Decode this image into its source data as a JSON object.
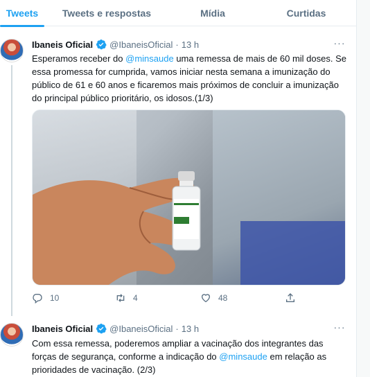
{
  "tabs": [
    {
      "label": "Tweets",
      "active": true
    },
    {
      "label": "Tweets e respostas",
      "active": false
    },
    {
      "label": "Mídia",
      "active": false
    },
    {
      "label": "Curtidas",
      "active": false
    }
  ],
  "colors": {
    "accent": "#1da1f2",
    "muted": "#5b7083",
    "text": "#0f1419"
  },
  "tweets": [
    {
      "name": "Ibaneis Oficial",
      "handle": "@IbaneisOficial",
      "time": "13 h",
      "text_before": "Esperamos receber do ",
      "mention": "@minsaude",
      "text_after": " uma remessa de mais de 60 mil doses. Se essa promessa for cumprida, vamos iniciar nesta semana a imunização do público de 61 e 60 anos e ficaremos mais próximos de concluir a imunização do principal público prioritário, os idosos.(1/3)",
      "media": {
        "icon": "vaccine-vial-photo",
        "vial_label_lines": [
          "vacina",
          "covid-19",
          "(recombinante)",
          "5 doses"
        ]
      },
      "reply_count": "10",
      "retweet_count": "4",
      "like_count": "48"
    },
    {
      "name": "Ibaneis Oficial",
      "handle": "@IbaneisOficial",
      "time": "13 h",
      "text_before": "Com essa remessa, poderemos ampliar a vacinação dos integrantes das forças de segurança, conforme a indicação do ",
      "mention": "@minsaude",
      "text_after": " em relação as prioridades de vacinação. (2/3)"
    }
  ],
  "separator": "·",
  "more_label": "···"
}
